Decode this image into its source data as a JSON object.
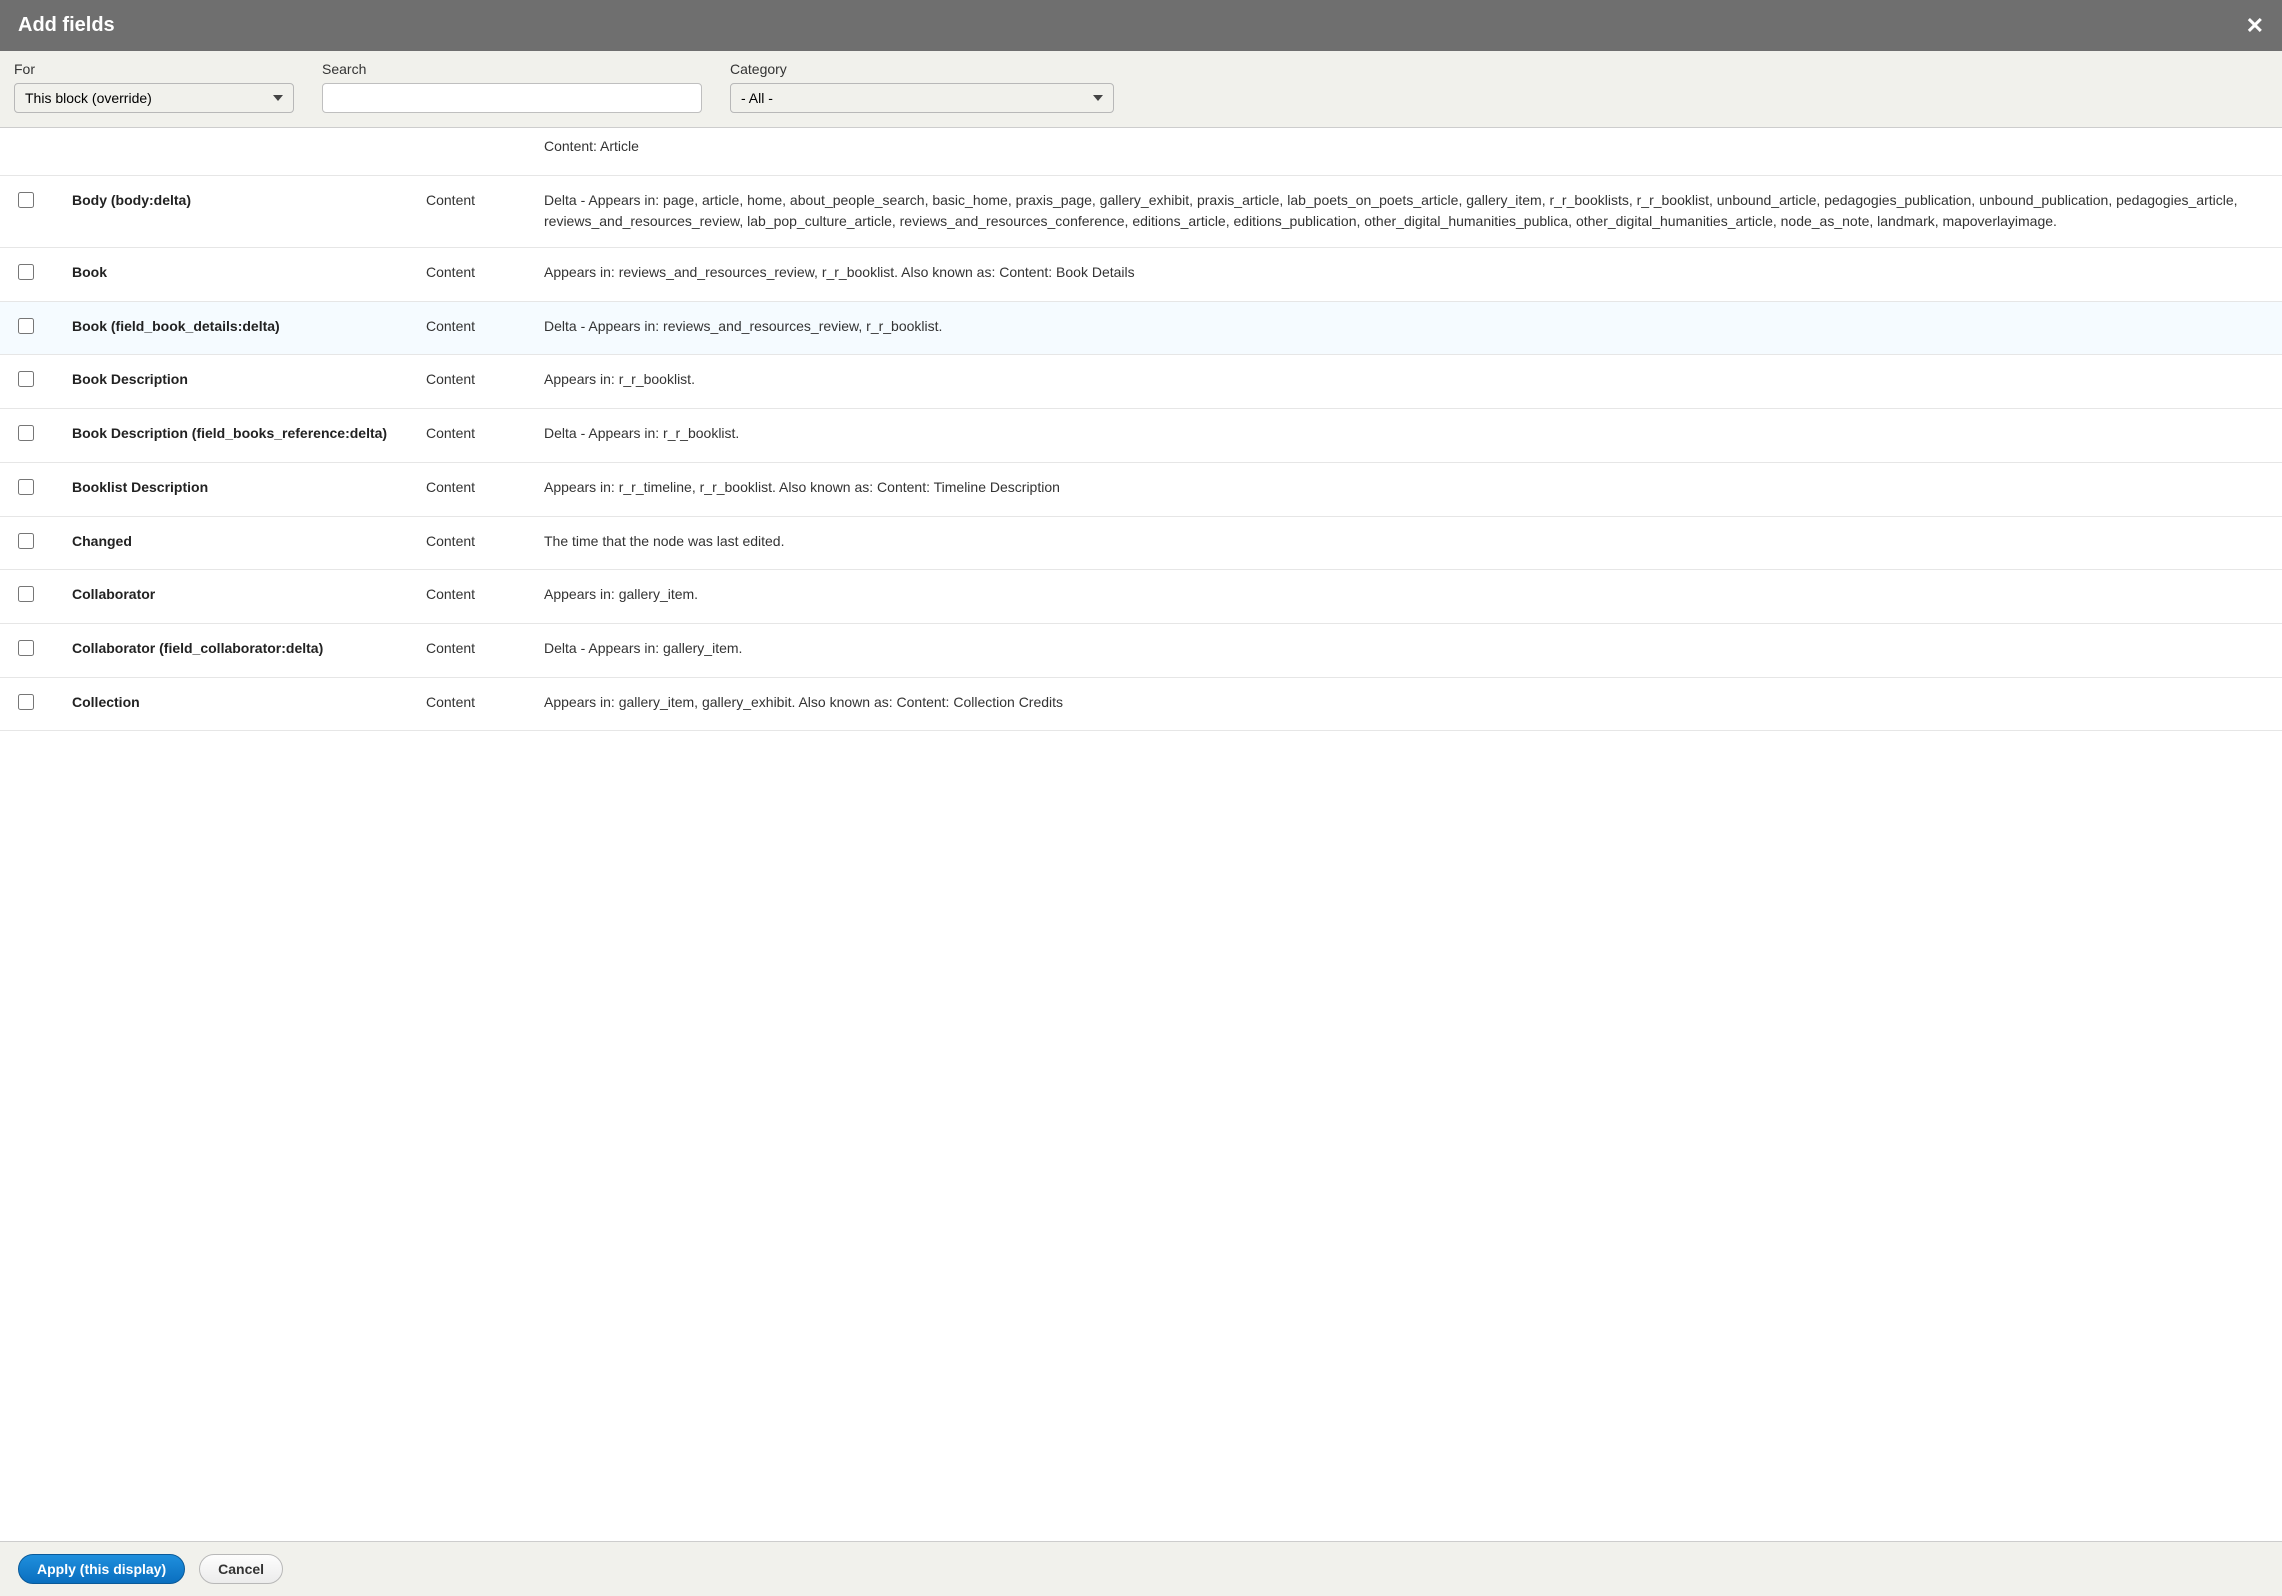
{
  "modal": {
    "title": "Add fields"
  },
  "filters": {
    "for": {
      "label": "For",
      "value": "This block (override)"
    },
    "search": {
      "label": "Search",
      "value": ""
    },
    "category": {
      "label": "Category",
      "value": "- All -"
    }
  },
  "partial_desc": "Content: Article",
  "rows": [
    {
      "title": "Body (body:delta)",
      "category": "Content",
      "desc": "Delta - Appears in: page, article, home, about_people_search, basic_home, praxis_page, gallery_exhibit, praxis_article, lab_poets_on_poets_article, gallery_item, r_r_booklists, r_r_booklist, unbound_article, pedagogies_publication, unbound_publication, pedagogies_article, reviews_and_resources_review, lab_pop_culture_article, reviews_and_resources_conference, editions_article, editions_publication, other_digital_humanities_publica, other_digital_humanities_article, node_as_note, landmark, mapoverlayimage."
    },
    {
      "title": "Book",
      "category": "Content",
      "desc": "Appears in: reviews_and_resources_review, r_r_booklist. Also known as: Content: Book Details"
    },
    {
      "title": "Book (field_book_details:delta)",
      "category": "Content",
      "desc": "Delta - Appears in: reviews_and_resources_review, r_r_booklist.",
      "highlighted": true
    },
    {
      "title": "Book Description",
      "category": "Content",
      "desc": "Appears in: r_r_booklist."
    },
    {
      "title": "Book Description (field_books_reference:delta)",
      "category": "Content",
      "desc": "Delta - Appears in: r_r_booklist."
    },
    {
      "title": "Booklist Description",
      "category": "Content",
      "desc": "Appears in: r_r_timeline, r_r_booklist. Also known as: Content: Timeline Description"
    },
    {
      "title": "Changed",
      "category": "Content",
      "desc": "The time that the node was last edited."
    },
    {
      "title": "Collaborator",
      "category": "Content",
      "desc": "Appears in: gallery_item."
    },
    {
      "title": "Collaborator (field_collaborator:delta)",
      "category": "Content",
      "desc": "Delta - Appears in: gallery_item."
    },
    {
      "title": "Collection",
      "category": "Content",
      "desc": "Appears in: gallery_item, gallery_exhibit. Also known as: Content: Collection Credits"
    }
  ],
  "footer": {
    "apply": "Apply (this display)",
    "cancel": "Cancel"
  }
}
